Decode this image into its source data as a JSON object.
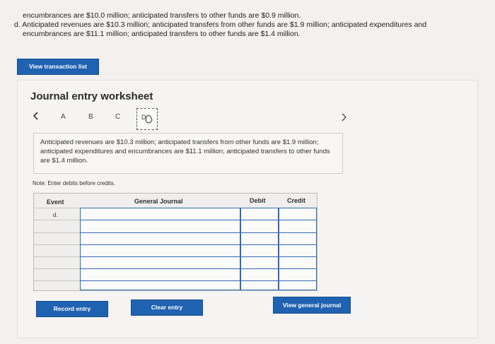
{
  "intro": {
    "line1": "encumbrances are $10.0 million; anticipated transfers to other funds are $0.9 million.",
    "line2": "d. Anticipated revenues are $10.3 million; anticipated transfers from other funds are $1.9 million; anticipated expenditures and",
    "line3": "encumbrances are $11.1 million; anticipated transfers to other funds are $1.4 million."
  },
  "buttons": {
    "view_transaction_list": "View transaction list",
    "record_entry": "Record entry",
    "clear_entry": "Clear entry",
    "view_general_journal": "View general journal"
  },
  "worksheet": {
    "title": "Journal entry worksheet",
    "tabs": [
      "A",
      "B",
      "C"
    ],
    "prev_icon": "chevron-left-icon",
    "next_icon": "chevron-right-icon",
    "current_tab_icon": "hand-pointer-icon",
    "description": "Anticipated revenues are $10.3 million; anticipated transfers from other funds are $1.9 million; anticipated expenditures and encumbrances are $11.1 million; anticipated transfers to other funds are $1.4 million.",
    "note": "Note: Enter debits before credits."
  },
  "table": {
    "headers": {
      "event": "Event",
      "general_journal": "General Journal",
      "debit": "Debit",
      "credit": "Credit"
    },
    "event_value": "d.",
    "rows": 7
  },
  "colors": {
    "accent": "#1f62b1",
    "cell_border": "#2f6bb0"
  }
}
